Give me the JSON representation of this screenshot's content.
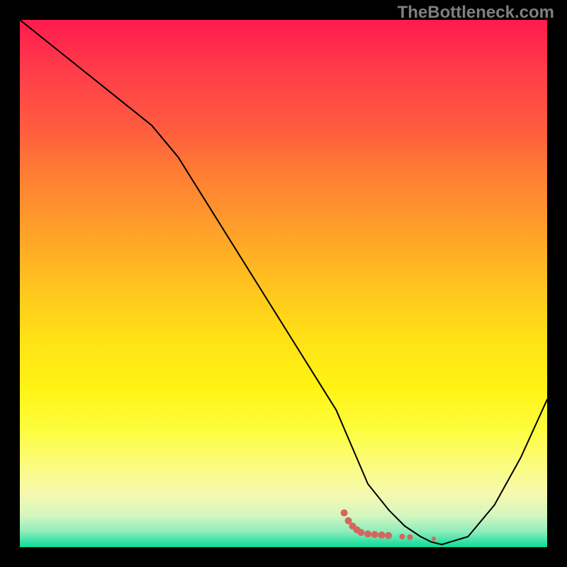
{
  "watermark": "TheBottleneck.com",
  "chart_data": {
    "type": "line",
    "title": "",
    "xlabel": "",
    "ylabel": "",
    "xlim": [
      0,
      100
    ],
    "ylim": [
      0,
      100
    ],
    "series": [
      {
        "name": "curve",
        "x": [
          0,
          5,
          10,
          15,
          20,
          25,
          30,
          35,
          40,
          45,
          50,
          55,
          60,
          63,
          66,
          70,
          73,
          76,
          78,
          80,
          85,
          90,
          95,
          100
        ],
        "values": [
          100,
          96,
          92,
          88,
          84,
          80,
          74,
          66,
          58,
          50,
          42,
          34,
          26,
          19,
          12,
          7,
          4,
          2,
          1,
          0.5,
          2,
          8,
          17,
          28
        ]
      }
    ],
    "markers": {
      "name": "highlight",
      "color": "#d5665e",
      "points": [
        {
          "x": 61.5,
          "y": 6.5,
          "r": 5
        },
        {
          "x": 62.3,
          "y": 5.0,
          "r": 5
        },
        {
          "x": 63.1,
          "y": 4.0,
          "r": 5
        },
        {
          "x": 63.9,
          "y": 3.3,
          "r": 5
        },
        {
          "x": 64.7,
          "y": 2.8,
          "r": 5
        },
        {
          "x": 66.0,
          "y": 2.5,
          "r": 5
        },
        {
          "x": 67.3,
          "y": 2.4,
          "r": 5
        },
        {
          "x": 68.6,
          "y": 2.3,
          "r": 5
        },
        {
          "x": 69.9,
          "y": 2.2,
          "r": 5
        },
        {
          "x": 72.5,
          "y": 2.0,
          "r": 4
        },
        {
          "x": 74.0,
          "y": 1.9,
          "r": 4
        },
        {
          "x": 78.5,
          "y": 1.6,
          "r": 3
        }
      ]
    }
  }
}
